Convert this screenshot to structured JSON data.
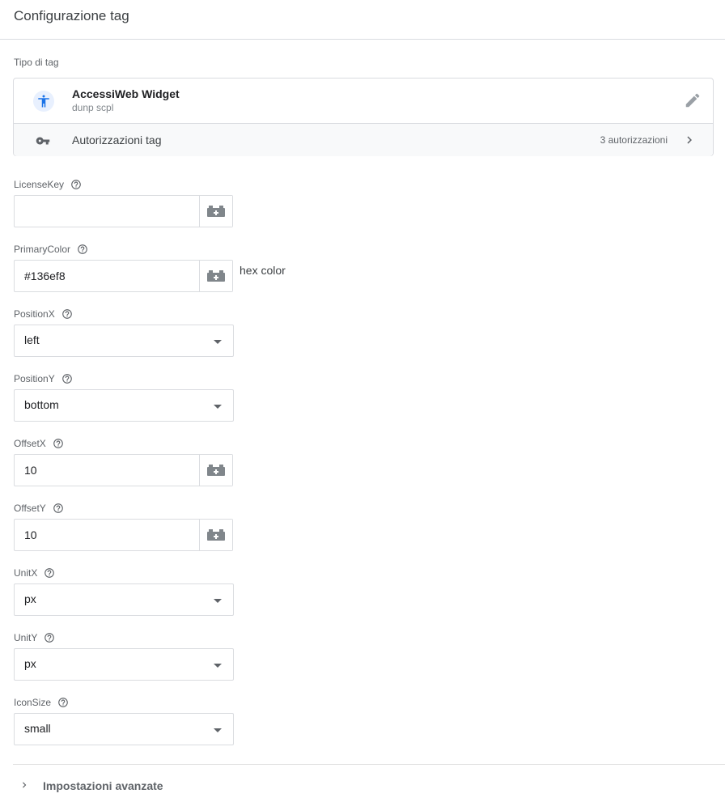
{
  "header": {
    "title": "Configurazione tag"
  },
  "tag_type": {
    "section_label": "Tipo di tag",
    "name": "AccessiWeb Widget",
    "subtitle": "dunp scpl",
    "icon": "accessibility-icon",
    "permissions_label": "Autorizzazioni tag",
    "permissions_count": "3 autorizzazioni"
  },
  "fields": {
    "license_key": {
      "label": "LicenseKey",
      "value": ""
    },
    "primary_color": {
      "label": "PrimaryColor",
      "value": "#136ef8",
      "hint": "hex color"
    },
    "position_x": {
      "label": "PositionX",
      "value": "left"
    },
    "position_y": {
      "label": "PositionY",
      "value": "bottom"
    },
    "offset_x": {
      "label": "OffsetX",
      "value": "10"
    },
    "offset_y": {
      "label": "OffsetY",
      "value": "10"
    },
    "unit_x": {
      "label": "UnitX",
      "value": "px"
    },
    "unit_y": {
      "label": "UnitY",
      "value": "px"
    },
    "icon_size": {
      "label": "IconSize",
      "value": "small"
    }
  },
  "advanced": {
    "label": "Impostazioni avanzate"
  },
  "colors": {
    "accent": "#1a73e8",
    "border": "#dadce0",
    "muted": "#5f6368"
  }
}
